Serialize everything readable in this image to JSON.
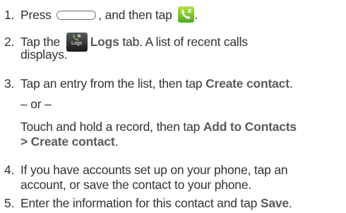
{
  "steps": [
    {
      "num": "1.",
      "a": "Press",
      "b": ", and then tap",
      "c": "."
    },
    {
      "num": "2.",
      "a": "Tap the",
      "bold": "Logs",
      "b": "tab. A list of recent calls",
      "line2": "displays.",
      "icon_text": "Logs"
    },
    {
      "num": "3.",
      "a": "Tap an entry from the list, then tap",
      "bold": "Create contact",
      "c": "."
    },
    {
      "or": "– or –"
    },
    {
      "line1": "Touch and hold a record, then tap",
      "bold1": "Add to Contacts",
      "line2_bold": "> Create contact",
      "c": "."
    },
    {
      "num": "4.",
      "line1": "If you have accounts set up on your phone, tap an",
      "line2": "account, or save the contact to your phone."
    },
    {
      "num": "5.",
      "line1": "Enter the information for this contact and tap",
      "bold": "Save",
      "c": "."
    }
  ],
  "icons": [
    "home-button-icon",
    "phone-icon",
    "logs-tab-icon"
  ],
  "colors": {
    "text": "#333333",
    "bold_text": "#5a5a5a",
    "phone_icon": "#6cc22f",
    "logs_icon_bg": "#2a2a2a"
  }
}
